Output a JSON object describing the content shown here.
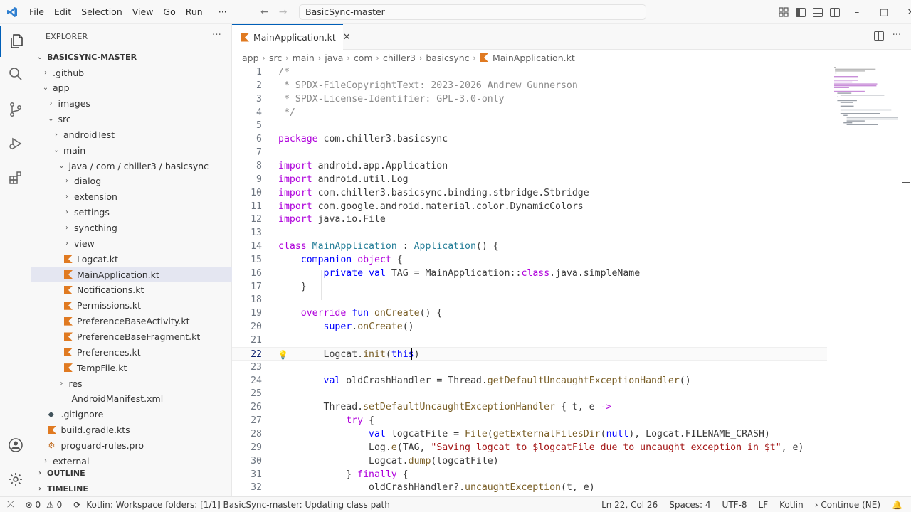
{
  "titlebar": {
    "menus": [
      "File",
      "Edit",
      "Selection",
      "View",
      "Go",
      "Run"
    ],
    "more": "···",
    "command_center": "BasicSync-master",
    "back_arrow": "←",
    "forward_arrow": "→",
    "minimize": "–",
    "restore": "□",
    "close": "✕"
  },
  "explorer": {
    "header": "EXPLORER",
    "more": "···",
    "root": "BASICSYNC-MASTER",
    "items": [
      {
        "label": ".github",
        "depth": 0,
        "chev": "›",
        "icon": "folder"
      },
      {
        "label": "app",
        "depth": 0,
        "chev": "⌄",
        "icon": "folder"
      },
      {
        "label": "images",
        "depth": 1,
        "chev": "›",
        "icon": "folder"
      },
      {
        "label": "src",
        "depth": 1,
        "chev": "⌄",
        "icon": "folder"
      },
      {
        "label": "androidTest",
        "depth": 2,
        "chev": "›",
        "icon": "folder"
      },
      {
        "label": "main",
        "depth": 2,
        "chev": "⌄",
        "icon": "folder"
      },
      {
        "label": "java / com / chiller3 / basicsync",
        "depth": 3,
        "chev": "⌄",
        "icon": "folder"
      },
      {
        "label": "dialog",
        "depth": 4,
        "chev": "›",
        "icon": "folder"
      },
      {
        "label": "extension",
        "depth": 4,
        "chev": "›",
        "icon": "folder"
      },
      {
        "label": "settings",
        "depth": 4,
        "chev": "›",
        "icon": "folder"
      },
      {
        "label": "syncthing",
        "depth": 4,
        "chev": "›",
        "icon": "folder"
      },
      {
        "label": "view",
        "depth": 4,
        "chev": "›",
        "icon": "folder"
      },
      {
        "label": "Logcat.kt",
        "depth": 4,
        "chev": "",
        "icon": "kotlin"
      },
      {
        "label": "MainApplication.kt",
        "depth": 4,
        "chev": "",
        "icon": "kotlin",
        "selected": true
      },
      {
        "label": "Notifications.kt",
        "depth": 4,
        "chev": "",
        "icon": "kotlin"
      },
      {
        "label": "Permissions.kt",
        "depth": 4,
        "chev": "",
        "icon": "kotlin"
      },
      {
        "label": "PreferenceBaseActivity.kt",
        "depth": 4,
        "chev": "",
        "icon": "kotlin"
      },
      {
        "label": "PreferenceBaseFragment.kt",
        "depth": 4,
        "chev": "",
        "icon": "kotlin"
      },
      {
        "label": "Preferences.kt",
        "depth": 4,
        "chev": "",
        "icon": "kotlin"
      },
      {
        "label": "TempFile.kt",
        "depth": 4,
        "chev": "",
        "icon": "kotlin"
      },
      {
        "label": "res",
        "depth": 3,
        "chev": "›",
        "icon": "folder"
      },
      {
        "label": "AndroidManifest.xml",
        "depth": 3,
        "chev": "",
        "icon": "xml"
      },
      {
        "label": ".gitignore",
        "depth": 1,
        "chev": "",
        "icon": "git"
      },
      {
        "label": "build.gradle.kts",
        "depth": 1,
        "chev": "",
        "icon": "kotlin"
      },
      {
        "label": "proguard-rules.pro",
        "depth": 1,
        "chev": "",
        "icon": "pro"
      },
      {
        "label": "external",
        "depth": 0,
        "chev": "›",
        "icon": "folder"
      }
    ],
    "outline": "OUTLINE",
    "timeline": "TIMELINE"
  },
  "editor": {
    "tab_label": "MainApplication.kt",
    "tab_close": "✕",
    "more": "···",
    "breadcrumb": [
      "app",
      "src",
      "main",
      "java",
      "com",
      "chiller3",
      "basicsync",
      "MainApplication.kt"
    ],
    "current_line": 22,
    "lines": [
      [
        [
          "c",
          "/*"
        ]
      ],
      [
        [
          "c",
          " * SPDX-FileCopyrightText: 2023-2026 Andrew Gunnerson"
        ]
      ],
      [
        [
          "c",
          " * SPDX-License-Identifier: GPL-3.0-only"
        ]
      ],
      [
        [
          "c",
          " */"
        ]
      ],
      [],
      [
        [
          "k",
          "package"
        ],
        [
          "",
          " com.chiller3.basicsync"
        ]
      ],
      [],
      [
        [
          "k",
          "import"
        ],
        [
          "",
          " android.app.Application"
        ]
      ],
      [
        [
          "k",
          "import"
        ],
        [
          "",
          " android.util.Log"
        ]
      ],
      [
        [
          "k",
          "import"
        ],
        [
          "",
          " com.chiller3.basicsync.binding.stbridge.Stbridge"
        ]
      ],
      [
        [
          "k",
          "import"
        ],
        [
          "",
          " com.google.android.material.color.DynamicColors"
        ]
      ],
      [
        [
          "k",
          "import"
        ],
        [
          "",
          " java.io.File"
        ]
      ],
      [],
      [
        [
          "k",
          "class"
        ],
        [
          "",
          " "
        ],
        [
          "t",
          "MainApplication"
        ],
        [
          "",
          " : "
        ],
        [
          "t",
          "Application"
        ],
        [
          "",
          "() {"
        ]
      ],
      [
        [
          "",
          "    "
        ],
        [
          "kw",
          "companion"
        ],
        [
          "",
          " "
        ],
        [
          "k",
          "object"
        ],
        [
          "",
          " {"
        ]
      ],
      [
        [
          "",
          "        "
        ],
        [
          "kw",
          "private"
        ],
        [
          "",
          " "
        ],
        [
          "kw",
          "val"
        ],
        [
          "",
          " TAG = MainApplication::"
        ],
        [
          "k",
          "class"
        ],
        [
          "",
          ".java.simpleName"
        ]
      ],
      [
        [
          "",
          "    }"
        ]
      ],
      [],
      [
        [
          "",
          "    "
        ],
        [
          "k",
          "override"
        ],
        [
          "",
          " "
        ],
        [
          "kw",
          "fun"
        ],
        [
          "",
          " "
        ],
        [
          "f",
          "onCreate"
        ],
        [
          "",
          "() {"
        ]
      ],
      [
        [
          "",
          "        "
        ],
        [
          "kw",
          "super"
        ],
        [
          "",
          "."
        ],
        [
          "f",
          "onCreate"
        ],
        [
          "",
          "()"
        ]
      ],
      [],
      [
        [
          "",
          "        Logcat."
        ],
        [
          "f",
          "init"
        ],
        [
          "",
          "("
        ],
        [
          "kw",
          "this"
        ],
        [
          "",
          ")"
        ]
      ],
      [],
      [
        [
          "",
          "        "
        ],
        [
          "kw",
          "val"
        ],
        [
          "",
          " oldCrashHandler = Thread."
        ],
        [
          "f",
          "getDefaultUncaughtExceptionHandler"
        ],
        [
          "",
          "()"
        ]
      ],
      [],
      [
        [
          "",
          "        Thread."
        ],
        [
          "f",
          "setDefaultUncaughtExceptionHandler"
        ],
        [
          "",
          " { t, e "
        ],
        [
          "k",
          "->"
        ]
      ],
      [
        [
          "",
          "            "
        ],
        [
          "k",
          "try"
        ],
        [
          "",
          " {"
        ]
      ],
      [
        [
          "",
          "                "
        ],
        [
          "kw",
          "val"
        ],
        [
          "",
          " logcatFile = "
        ],
        [
          "f",
          "File"
        ],
        [
          "",
          "("
        ],
        [
          "f",
          "getExternalFilesDir"
        ],
        [
          "",
          "("
        ],
        [
          "kw",
          "null"
        ],
        [
          "",
          "), Logcat.FILENAME_CRASH)"
        ]
      ],
      [
        [
          "",
          "                Log."
        ],
        [
          "f",
          "e"
        ],
        [
          "",
          "(TAG, "
        ],
        [
          "s",
          "\"Saving logcat to $logcatFile due to uncaught exception in $t\""
        ],
        [
          "",
          ", e)"
        ]
      ],
      [
        [
          "",
          "                Logcat."
        ],
        [
          "f",
          "dump"
        ],
        [
          "",
          "(logcatFile)"
        ]
      ],
      [
        [
          "",
          "            } "
        ],
        [
          "k",
          "finally"
        ],
        [
          "",
          " {"
        ]
      ],
      [
        [
          "",
          "                oldCrashHandler?."
        ],
        [
          "f",
          "uncaughtException"
        ],
        [
          "",
          "(t, e)"
        ]
      ]
    ]
  },
  "statusbar": {
    "remote": "⤫",
    "errors": "0",
    "warnings": "0",
    "message": "Kotlin: Workspace folders: [1/1] BasicSync-master: Updating class path",
    "position": "Ln 22, Col 26",
    "spaces": "Spaces: 4",
    "encoding": "UTF-8",
    "eol": "LF",
    "language": "Kotlin",
    "continue": "Continue (NE)",
    "bell": "🔔"
  }
}
